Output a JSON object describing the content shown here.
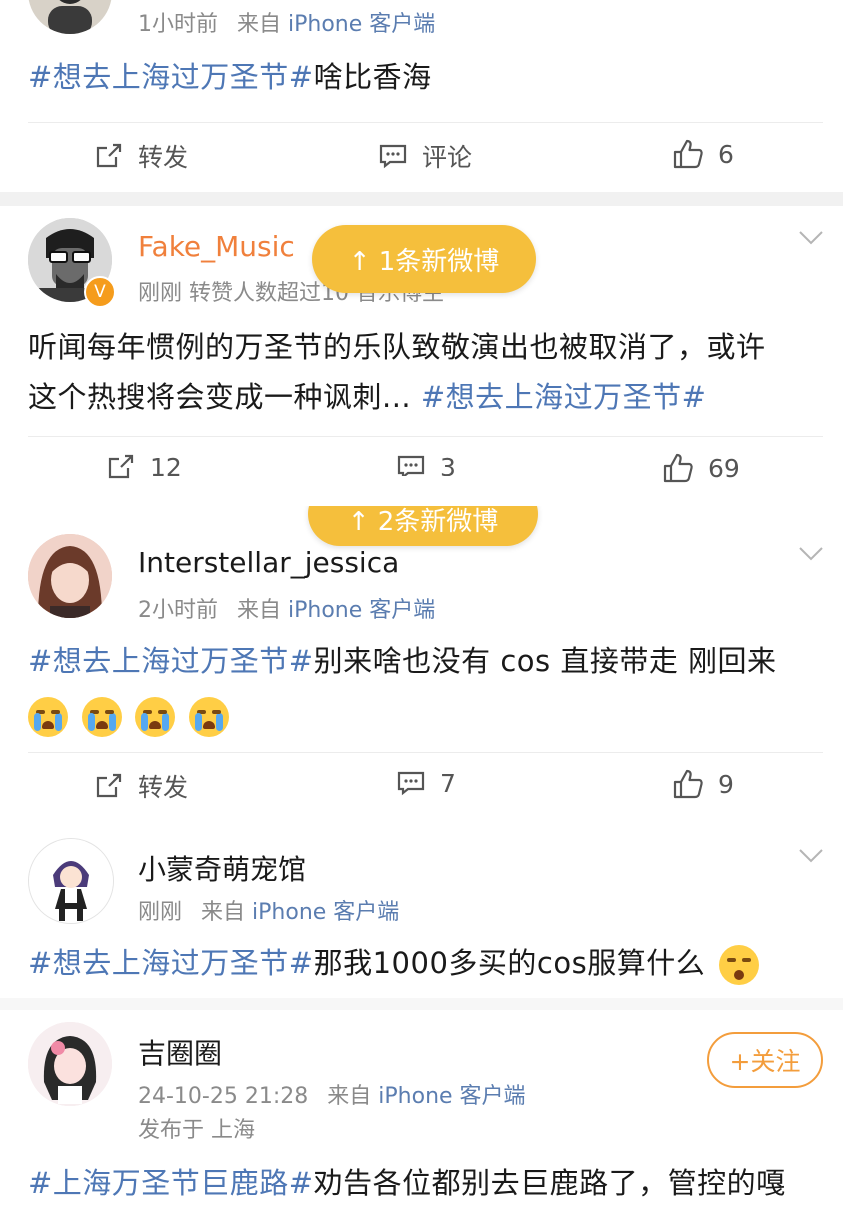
{
  "colors": {
    "accent": "#f5bf3c",
    "tag": "#4e77b5",
    "source_link": "#5b7db0",
    "follow": "#f39d3c"
  },
  "posts": [
    {
      "time": "1小时前",
      "source_prefix": "来自",
      "source": "iPhone 客户端",
      "text": {
        "tag": "#想去上海过万圣节#",
        "rest": "啥比香海"
      },
      "actions": {
        "repost": "转发",
        "comment": "评论",
        "like": "6"
      }
    },
    {
      "user_name": "Fake_Music",
      "meta_text": "刚刚  转赞人数超过10  音乐博主",
      "text": {
        "line1": "听闻每年惯例的万圣节的乐队致敬演出也被取消了，或许",
        "line2_plain": "这个热搜将会变成一种讽刺... ",
        "line2_tag": "#想去上海过万圣节#"
      },
      "actions": {
        "repost": "12",
        "comment": "3",
        "like": "69"
      }
    },
    {
      "user_name": "Interstellar_jessica",
      "time": "2小时前",
      "source_prefix": "来自",
      "source": "iPhone 客户端",
      "text": {
        "tag": "#想去上海过万圣节#",
        "rest": "别来啥也没有 cos 直接带走 刚回来"
      },
      "emoji_count": 4,
      "actions": {
        "repost": "转发",
        "comment": "7",
        "like": "9"
      }
    },
    {
      "user_name": "小蒙奇萌宠馆",
      "time": "刚刚",
      "source_prefix": "来自",
      "source": "iPhone 客户端",
      "text": {
        "tag": "#想去上海过万圣节#",
        "rest": "那我1000多买的cos服算什么"
      }
    },
    {
      "user_name": "吉圈圈",
      "time": "24-10-25 21:28",
      "source_prefix": "来自",
      "source": "iPhone 客户端",
      "location": "发布于 上海",
      "follow_label": "+关注",
      "text": {
        "tag": "#上海万圣节巨鹿路#",
        "rest": "劝告各位都别去巨鹿路了，管控的嘎"
      }
    }
  ],
  "new_posts_pill_1": "↑ 1条新微博",
  "new_posts_pill_2": "↑ 2条新微博"
}
